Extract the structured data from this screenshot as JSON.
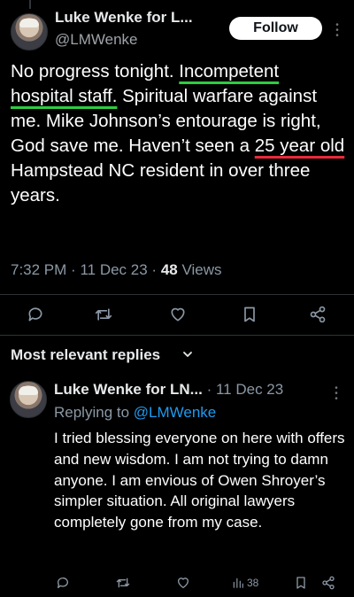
{
  "tweet": {
    "author_name": "Luke Wenke for L...",
    "handle": "@LMWenke",
    "follow_label": "Follow",
    "text_segments": [
      {
        "text": "No progress tonight.  ",
        "mark": ""
      },
      {
        "text": "Incompetent hospital staff.",
        "mark": "green"
      },
      {
        "text": "  Spiritual warfare against me.  Mike Johnson’s entourage is right, God save me.  Haven’t seen a ",
        "mark": ""
      },
      {
        "text": "25 year old",
        "mark": "red"
      },
      {
        "text": " Hampstead NC resident in over three years.",
        "mark": ""
      }
    ],
    "time": "7:32 PM",
    "date": "11 Dec 23",
    "views_count": "48",
    "views_label": "Views",
    "separator": "·",
    "annotation_colors": {
      "green": "#2ecc40",
      "red": "#e8293b"
    }
  },
  "actions": [
    {
      "icon": "reply-icon"
    },
    {
      "icon": "retweet-icon"
    },
    {
      "icon": "like-icon"
    },
    {
      "icon": "bookmark-icon"
    },
    {
      "icon": "share-icon"
    }
  ],
  "replies_section": {
    "sort_label": "Most relevant replies"
  },
  "reply": {
    "author_name": "Luke Wenke for LN...",
    "separator": "·",
    "date": "11 Dec 23",
    "replying_prefix": "Replying to ",
    "replying_to": "@LMWenke",
    "text": "I tried blessing everyone on here with offers and new wisdom.  I am not trying to damn anyone.  I am envious of Owen Shroyer’s simpler situation.  All original lawyers completely gone from my case.",
    "views_count": "38"
  },
  "colors": {
    "background": "#000000",
    "text": "#e7e9ea",
    "muted": "#8b98a5",
    "accent": "#1d9bf0"
  }
}
